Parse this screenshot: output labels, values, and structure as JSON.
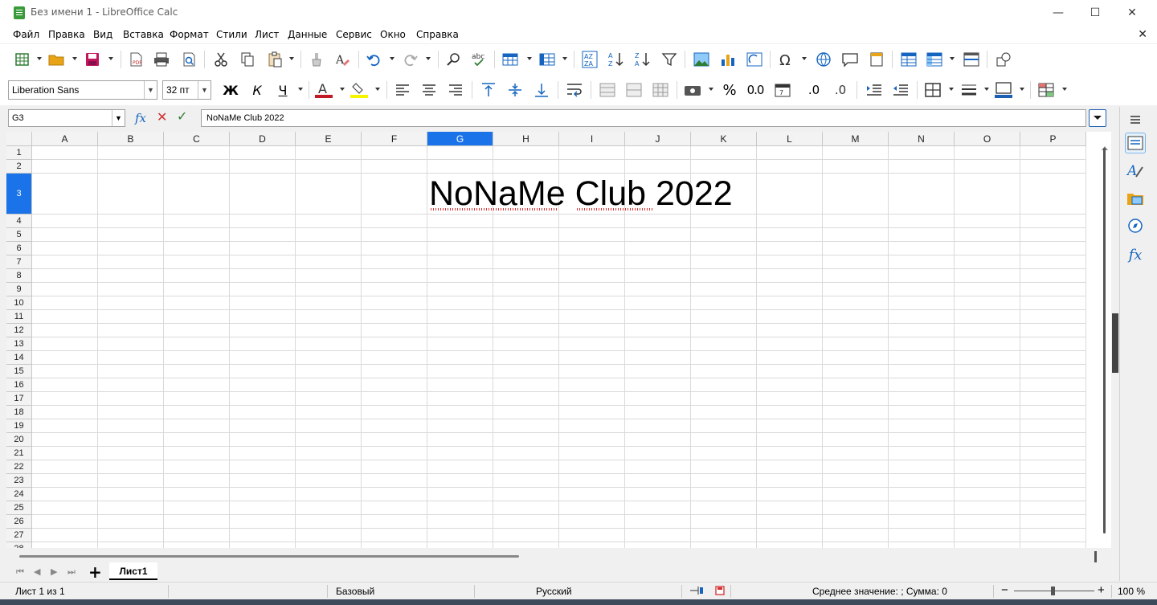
{
  "window": {
    "title": "Без имени 1 - LibreOffice Calc",
    "minimize": "—",
    "maximize": "☐",
    "close": "✕"
  },
  "menu": [
    "Файл",
    "Правка",
    "Вид",
    "Вставка",
    "Формат",
    "Стили",
    "Лист",
    "Данные",
    "Сервис",
    "Окно",
    "Справка"
  ],
  "close_doc": "✕",
  "font": {
    "name": "Liberation Sans",
    "size": "32 пт"
  },
  "format_buttons": {
    "bold": "Ж",
    "italic": "К",
    "underline": "Ч",
    "percent": "%",
    "number": "0.0",
    "add_decimal": ".0",
    "del_decimal": ".0"
  },
  "colors": {
    "font_color": "#c01c28",
    "highlight": "#f6f500",
    "selection": "#1a73e8",
    "border_color": "#1a5fb4"
  },
  "formula": {
    "cell_ref": "G3",
    "content": "NoNaMe Club 2022",
    "fx": "fx",
    "cancel": "✕",
    "accept": "✓"
  },
  "columns": [
    "A",
    "B",
    "C",
    "D",
    "E",
    "F",
    "G",
    "H",
    "I",
    "J",
    "K",
    "L",
    "M",
    "N",
    "O",
    "P"
  ],
  "selected_column": "G",
  "rows": [
    "1",
    "2",
    "3",
    "4",
    "5",
    "6",
    "7",
    "8",
    "9",
    "10",
    "11",
    "12",
    "13",
    "14",
    "15",
    "16",
    "17",
    "18",
    "19",
    "20",
    "21",
    "22",
    "23",
    "24",
    "25",
    "26",
    "27",
    "28"
  ],
  "selected_row": "3",
  "cell_G3": "NoNaMe Club 2022",
  "sheets": {
    "add": "+",
    "tab": "Лист1"
  },
  "status": {
    "sheet_info": "Лист 1 из 1",
    "page_style": "Базовый",
    "language": "Русский",
    "summary": "Среднее значение: ; Сумма: 0",
    "zoom": "100 %",
    "zoom_minus": "−",
    "zoom_plus": "+"
  }
}
